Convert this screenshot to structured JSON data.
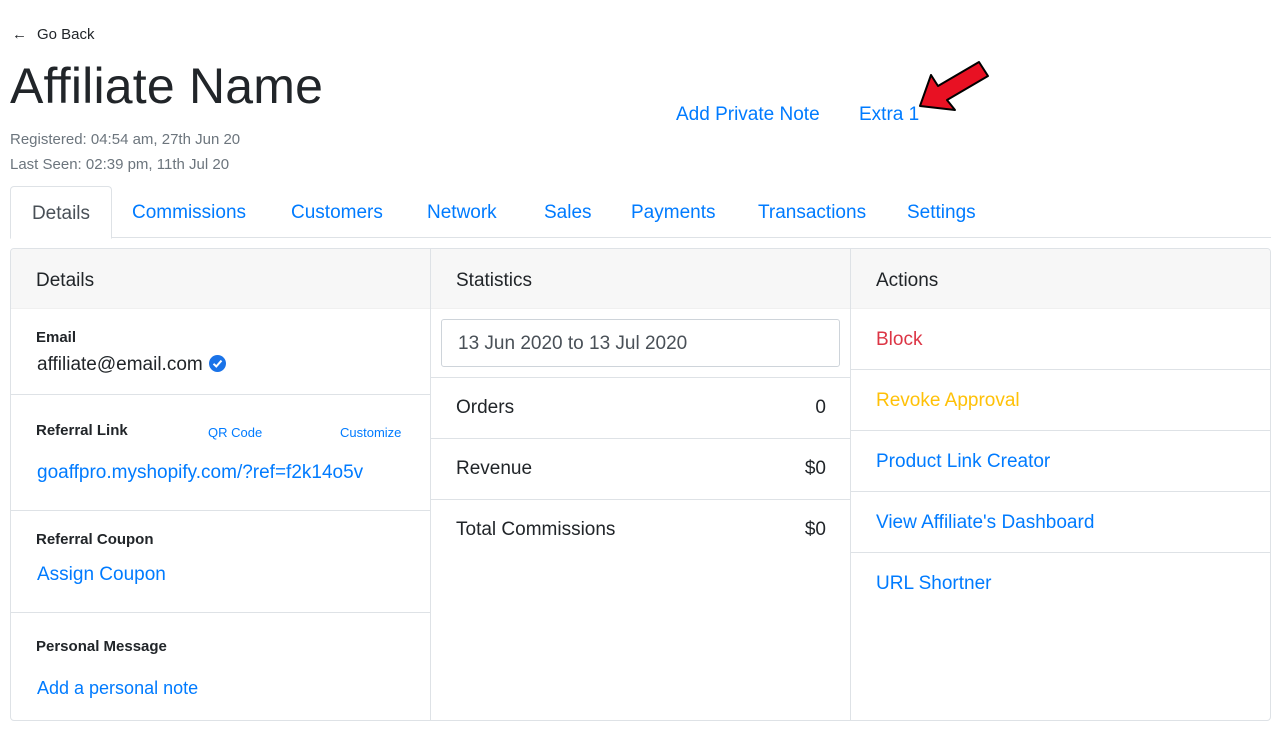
{
  "header": {
    "go_back": "Go Back",
    "title": "Affiliate Name",
    "registered": "Registered: 04:54 am, 27th Jun 20",
    "last_seen": "Last Seen: 02:39 pm, 11th Jul 20",
    "add_private_note": "Add Private Note",
    "extra": "Extra 1"
  },
  "tabs": [
    {
      "label": "Details",
      "active": true
    },
    {
      "label": "Commissions"
    },
    {
      "label": "Customers"
    },
    {
      "label": "Network"
    },
    {
      "label": "Sales"
    },
    {
      "label": "Payments"
    },
    {
      "label": "Transactions"
    },
    {
      "label": "Settings"
    }
  ],
  "details": {
    "header": "Details",
    "email_label": "Email",
    "email_value": "affiliate@email.com",
    "referral_link_label": "Referral Link",
    "qr_code": "QR Code",
    "customize": "Customize",
    "referral_link_value": "goaffpro.myshopify.com/?ref=f2k14o5v",
    "referral_coupon_label": "Referral Coupon",
    "assign_coupon": "Assign Coupon",
    "personal_message_label": "Personal Message",
    "add_note": "Add a personal note"
  },
  "statistics": {
    "header": "Statistics",
    "date_range": "13 Jun 2020 to 13 Jul 2020",
    "rows": [
      {
        "label": "Orders",
        "value": "0"
      },
      {
        "label": "Revenue",
        "value": "$0"
      },
      {
        "label": "Total Commissions",
        "value": "$0"
      }
    ]
  },
  "actions": {
    "header": "Actions",
    "items": [
      {
        "label": "Block",
        "color": "#dc3545"
      },
      {
        "label": "Revoke Approval",
        "color": "#ffc107"
      },
      {
        "label": "Product Link Creator",
        "color": "#007bff"
      },
      {
        "label": "View Affiliate's Dashboard",
        "color": "#007bff"
      },
      {
        "label": "URL Shortner",
        "color": "#007bff"
      }
    ]
  },
  "colors": {
    "link": "#007bff",
    "annotation_arrow": "#e81123"
  },
  "icons": {
    "back": "arrow-left-icon",
    "verified": "verified-check-icon",
    "annotation": "red-arrow-icon"
  }
}
